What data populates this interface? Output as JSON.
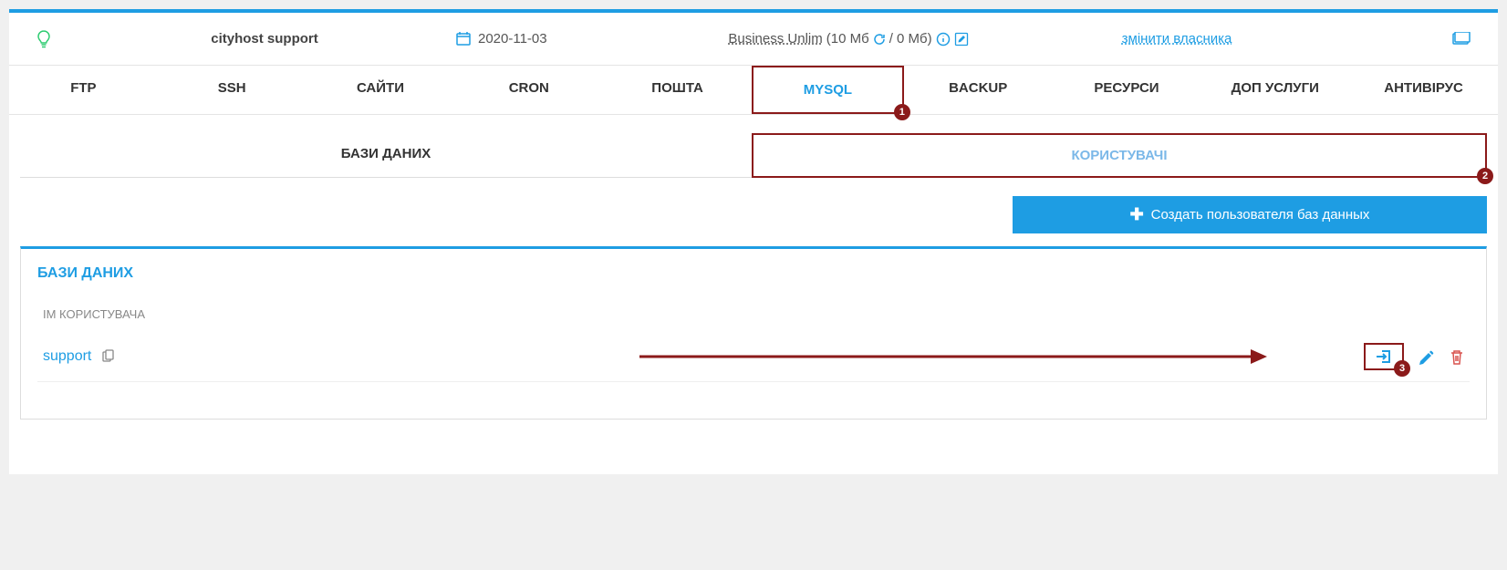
{
  "header": {
    "account": "cityhost support",
    "date": "2020-11-03",
    "plan_name": "Business Unlim",
    "plan_usage_prefix": "(10 Мб",
    "plan_usage_suffix": "/ 0 Мб)",
    "change_owner": "змінити власника"
  },
  "nav": {
    "ftp": "FTP",
    "ssh": "SSH",
    "sites": "САЙТИ",
    "cron": "CRON",
    "mail": "ПОШТА",
    "mysql": "MYSQL",
    "backup": "BACKUP",
    "resources": "РЕСУРСИ",
    "extras": "ДОП УСЛУГИ",
    "antivirus": "АНТИВІРУС"
  },
  "subtabs": {
    "databases": "БАЗИ ДАНИХ",
    "users": "КОРИСТУВАЧІ"
  },
  "buttons": {
    "create_user": "Создать пользователя баз данных"
  },
  "section": {
    "title": "БАЗИ ДАНИХ",
    "col_username": "ІМ КОРИСТУВАЧА"
  },
  "rows": [
    {
      "username": "support"
    }
  ],
  "annotations": {
    "b1": "1",
    "b2": "2",
    "b3": "3"
  }
}
